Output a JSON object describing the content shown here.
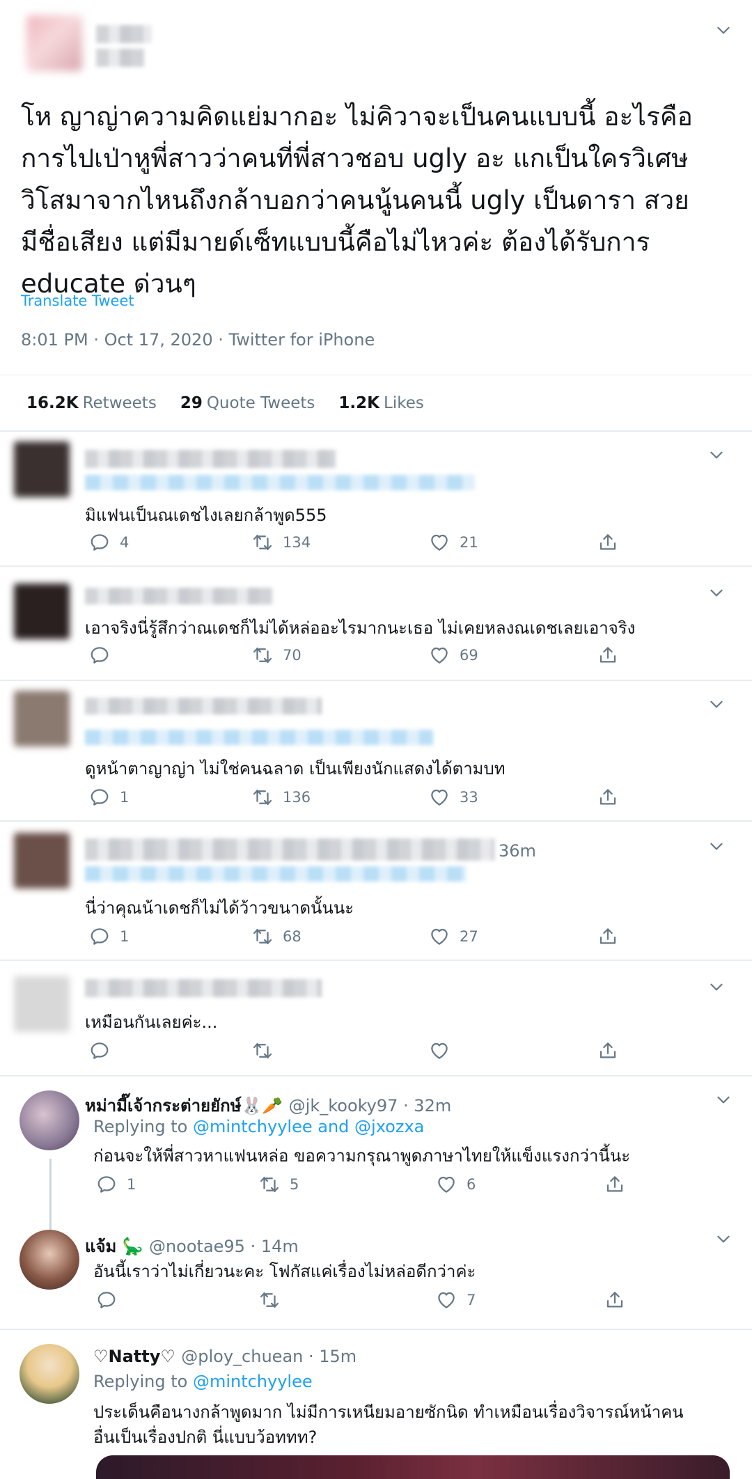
{
  "main_tweet": {
    "text_lines": [
      "โห ญาญ่าความคิดแย่มากอะ ไม่คิวาจะเป็นคนแบบนี้ อะไรคือ",
      "การไปเป่าหูพี่สาวว่าคนที่พี่สาวชอบ ugly อะ แกเป็นใครวิเศษ",
      "วิโสมาจากไหนถึงกล้าบอกว่าคนนู้นคนนี้ ugly เป็นดารา สวย",
      "มีชื่อเสียง แต่มีมายด์เซ็ทแบบนี้คือไม่ไหวค่ะ ต้องได้รับการ",
      "educate ด่วนๆ"
    ],
    "translate_label": "Translate Tweet",
    "time": "8:01 PM · Oct 17, 2020",
    "source": "Twitter for iPhone",
    "stats": {
      "retweets_count": "16.2K",
      "retweets_label": "Retweets",
      "quotes_count": "29",
      "quotes_label": "Quote Tweets",
      "likes_count": "1.2K",
      "likes_label": "Likes"
    }
  },
  "replies": [
    {
      "text": "มิแฟนเป็นณเดชไงเลยกล้าพูด555",
      "replies": "4",
      "retweets": "134",
      "likes": "21"
    },
    {
      "text": "เอาจริงนี่รู้สึกว่าณเดชก็ไม่ได้หล่ออะไรมากนะเธอ ไม่เคยหลงณเดชเลยเอาจริง",
      "replies": "",
      "retweets": "70",
      "likes": "69"
    },
    {
      "text": "ดูหน้าตาญาญ่า ไม่ใช่คนฉลาด เป็นเพียงนักแสดงได้ตามบท",
      "replies": "1",
      "retweets": "136",
      "likes": "33"
    },
    {
      "text": "นี่ว่าคุณน้าเดชก็ไม่ได้ว้าวขนาดนั้นนะ",
      "time_fragment": "36m",
      "replies": "1",
      "retweets": "68",
      "likes": "27"
    },
    {
      "text": "เหมือนกันเลยค่ะ...",
      "replies": "",
      "retweets": "",
      "likes": ""
    },
    {
      "name": "หม่ามี๊เจ้ากระต่ายยักษ์🐰🥕",
      "handle": "@jk_kooky97 · 32m",
      "replying_prefix": "Replying to ",
      "replying_users": "@mintchyylee and @jxozxa",
      "text": "ก่อนจะให้พี่สาวหาแฟนหล่อ ขอความกรุณาพูดภาษาไทยให้แข็งแรงกว่านี้นะ",
      "replies": "1",
      "retweets": "5",
      "likes": "6"
    },
    {
      "name": "แจ้ม 🦕",
      "handle": "@nootae95 · 14m",
      "text": "อันนี้เราว่าไม่เกี่ยวนะคะ โฟกัสแค่เรื่องไม่หล่อดีกว่าค่ะ",
      "replies": "",
      "retweets": "",
      "likes": "7"
    },
    {
      "name": "♡Natty♡",
      "handle": "@ploy_chuean · 15m",
      "replying_prefix": "Replying to ",
      "replying_users": "@mintchyylee",
      "text_lines": [
        "ประเด็นคือนางกล้าพูดมาก ไม่มีการเหนียมอายซักนิด ทำเหมือนเรื่องวิจารณ์หน้าคน",
        "อื่นเป็นเรื่องปกติ นี่แบบว้อททท?"
      ]
    }
  ],
  "colors": {
    "text": "#14171a",
    "muted": "#657786",
    "link": "#1da1f2",
    "border": "#e6ecf0"
  },
  "icons": [
    "chevron-down-icon",
    "reply-icon",
    "retweet-icon",
    "like-icon",
    "share-icon"
  ]
}
